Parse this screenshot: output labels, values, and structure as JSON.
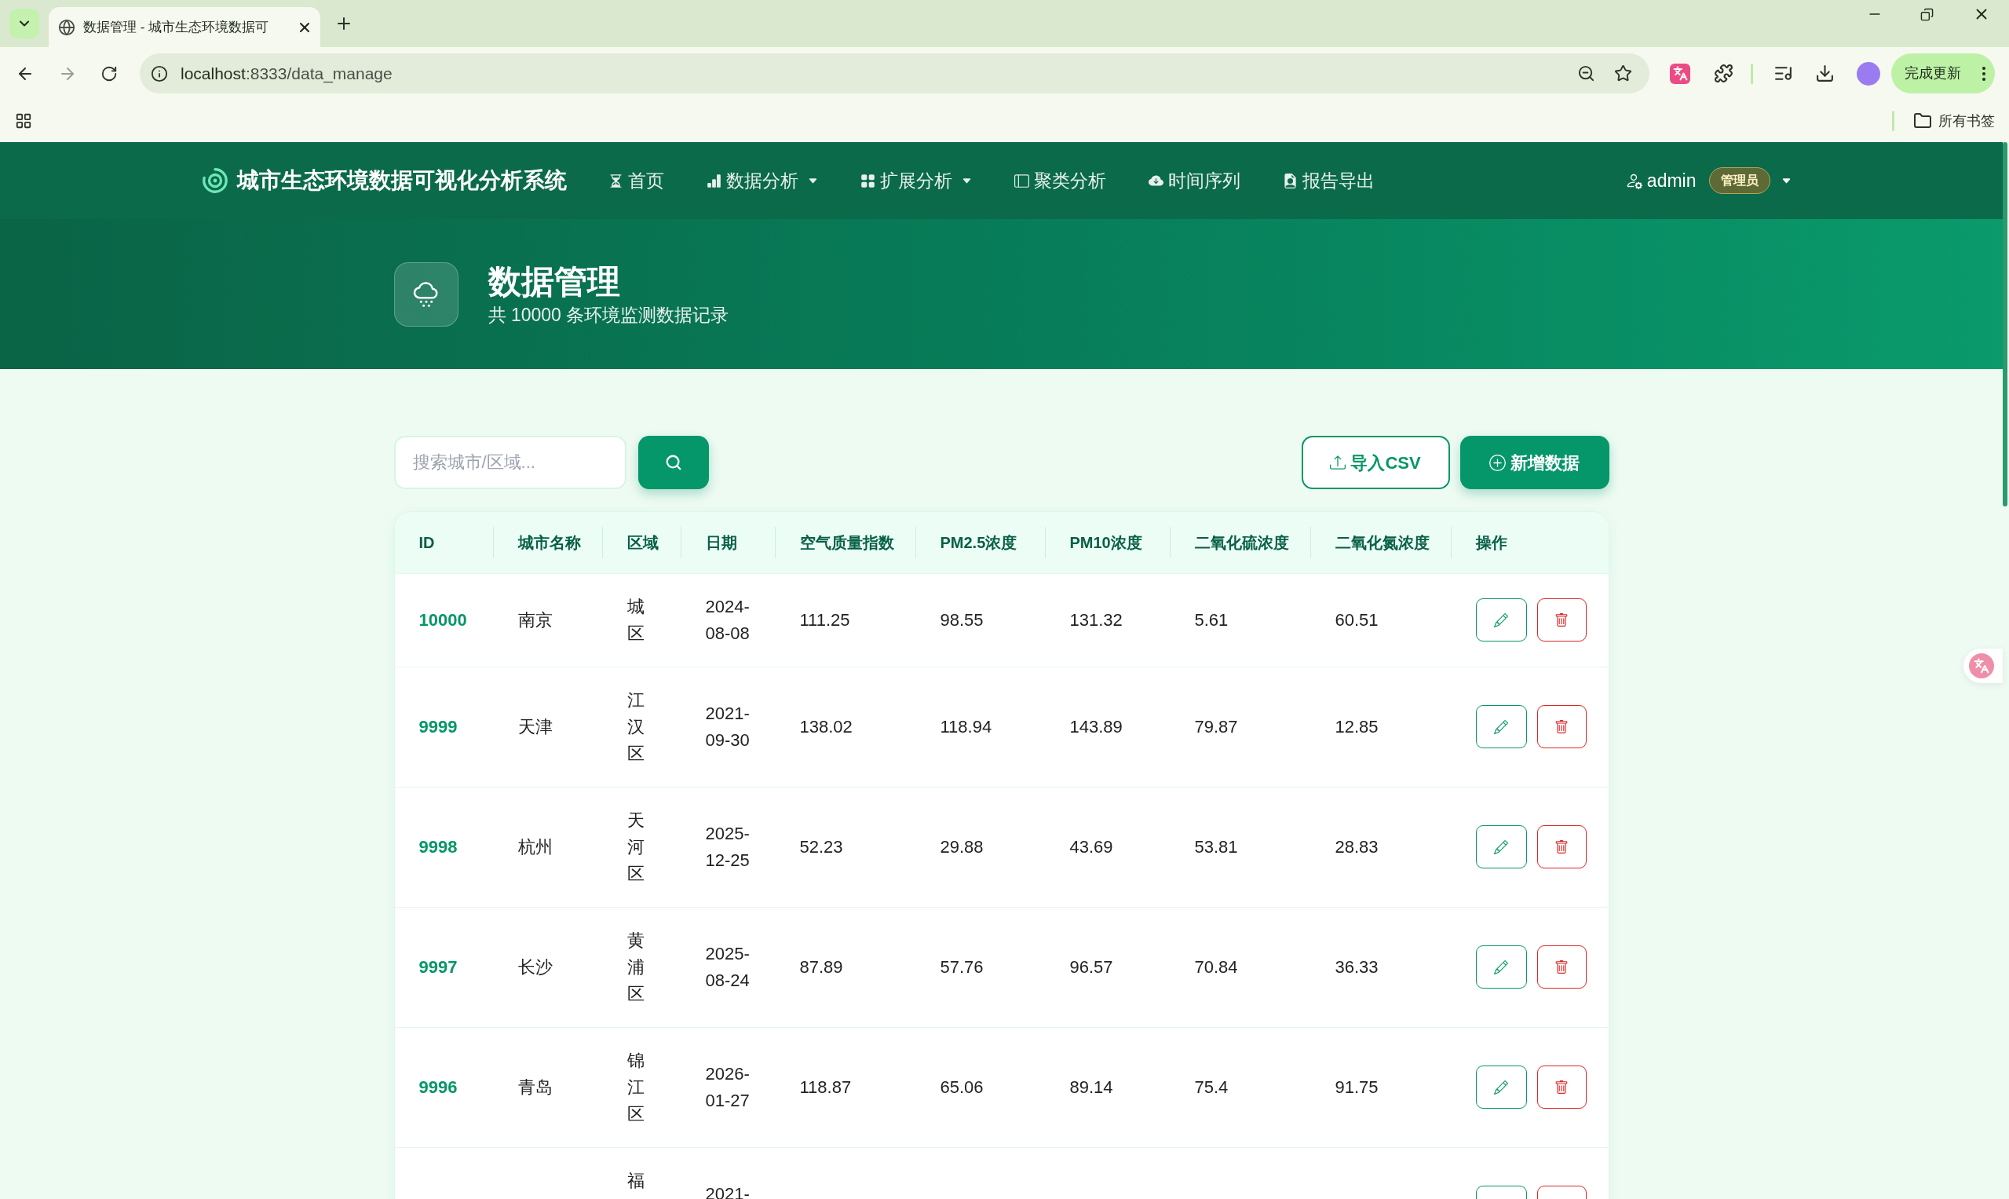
{
  "browser": {
    "tab_title": "数据管理 - 城市生态环境数据可",
    "url_host": "localhost",
    "url_path": ":8333/data_manage",
    "update_button": "完成更新",
    "bookmarks_folder": "所有书签"
  },
  "navbar": {
    "brand": "城市生态环境数据可视化分析系统",
    "items": [
      {
        "label": "首页",
        "has_menu": false
      },
      {
        "label": "数据分析",
        "has_menu": true
      },
      {
        "label": "扩展分析",
        "has_menu": true
      },
      {
        "label": "聚类分析",
        "has_menu": false
      },
      {
        "label": "时间序列",
        "has_menu": false
      },
      {
        "label": "报告导出",
        "has_menu": false
      }
    ],
    "user": {
      "name": "admin",
      "badge": "管理员",
      "has_menu": true
    }
  },
  "header": {
    "title": "数据管理",
    "subtitle": "共 10000 条环境监测数据记录"
  },
  "toolbar": {
    "search": {
      "placeholder": "搜索城市/区域..."
    },
    "buttons": [
      {
        "label": "导入CSV",
        "kind": "outline"
      },
      {
        "label": "新增数据",
        "kind": "primary"
      }
    ]
  },
  "table": {
    "columns": [
      "ID",
      "城市名称",
      "区域",
      "日期",
      "空气质量指数",
      "PM2.5浓度",
      "PM10浓度",
      "二氧化硫浓度",
      "二氧化氮浓度",
      "操作"
    ],
    "rows": [
      {
        "id": "10000",
        "city": "南京",
        "district": "城区",
        "date": "2024-08-08",
        "aqi": "111.25",
        "pm25": "98.55",
        "pm10": "131.32",
        "so2": "5.61",
        "no2": "60.51"
      },
      {
        "id": "9999",
        "city": "天津",
        "district": "江汉区",
        "date": "2021-09-30",
        "aqi": "138.02",
        "pm25": "118.94",
        "pm10": "143.89",
        "so2": "79.87",
        "no2": "12.85"
      },
      {
        "id": "9998",
        "city": "杭州",
        "district": "天河区",
        "date": "2025-12-25",
        "aqi": "52.23",
        "pm25": "29.88",
        "pm10": "43.69",
        "so2": "53.81",
        "no2": "28.83"
      },
      {
        "id": "9997",
        "city": "长沙",
        "district": "黄浦区",
        "date": "2025-08-24",
        "aqi": "87.89",
        "pm25": "57.76",
        "pm10": "96.57",
        "so2": "70.84",
        "no2": "36.33"
      },
      {
        "id": "9996",
        "city": "青岛",
        "district": "锦江区",
        "date": "2026-01-27",
        "aqi": "118.87",
        "pm25": "65.06",
        "pm10": "89.14",
        "so2": "75.4",
        "no2": "91.75"
      },
      {
        "district": "福",
        "date": "2021-"
      }
    ]
  }
}
